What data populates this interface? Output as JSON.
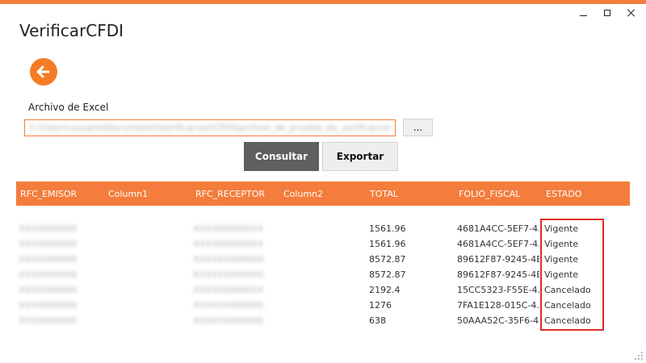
{
  "window": {
    "title": "VerificarCFDI",
    "controls": {
      "minimize": "—",
      "maximize": "□",
      "close": "×"
    },
    "accent_color": "#f47c3c"
  },
  "form": {
    "file_label": "Archivo de Excel",
    "file_value": "C:\\Users\\usuario\\Documents\\Verificacion\\CFDI\\archivo_de_prueba_de_verificacion.xlsx",
    "browse_label": "...",
    "consult_label": "Consultar",
    "export_label": "Exportar"
  },
  "table": {
    "headers": [
      "RFC_EMISOR",
      "Column1",
      "RFC_RECEPTOR",
      "Column2",
      "TOTAL",
      "FOLIO_FISCAL",
      "ESTADO"
    ],
    "rows": [
      {
        "rfc_emisor": "XXXX000000XX0",
        "rfc_receptor": "XXXX000000XX0",
        "total": "1561.96",
        "folio_fiscal": "4681A4CC-5EF7-4...",
        "estado": "Vigente"
      },
      {
        "rfc_emisor": "XXXX000000XX0",
        "rfc_receptor": "XXXX000000XX0",
        "total": "1561.96",
        "folio_fiscal": "4681A4CC-5EF7-4...",
        "estado": "Vigente"
      },
      {
        "rfc_emisor": "XXXX000000XX0",
        "rfc_receptor": "XXXXXX000000XX0",
        "total": "8572.87",
        "folio_fiscal": "89612F87-9245-4B...",
        "estado": "Vigente"
      },
      {
        "rfc_emisor": "XXXX000000XX0",
        "rfc_receptor": "XXXXXX000000XX0",
        "total": "8572.87",
        "folio_fiscal": "89612F87-9245-4B...",
        "estado": "Vigente"
      },
      {
        "rfc_emisor": "XXXX000000XX0",
        "rfc_receptor": "XXXX000000XX0",
        "total": "2192.4",
        "folio_fiscal": "15CC5323-F55E-4...",
        "estado": "Cancelado"
      },
      {
        "rfc_emisor": "XXXX000000XX0",
        "rfc_receptor": "XXXXXX000000XX0",
        "total": "1276",
        "folio_fiscal": "7FA1E128-015C-4...",
        "estado": "Cancelado"
      },
      {
        "rfc_emisor": "XXXX000000XX0",
        "rfc_receptor": "XXXXXX000000XX0",
        "total": "638",
        "folio_fiscal": "50AAA52C-35F6-4...",
        "estado": "Cancelado"
      }
    ]
  },
  "icons": {
    "back": "arrow-left-icon"
  }
}
